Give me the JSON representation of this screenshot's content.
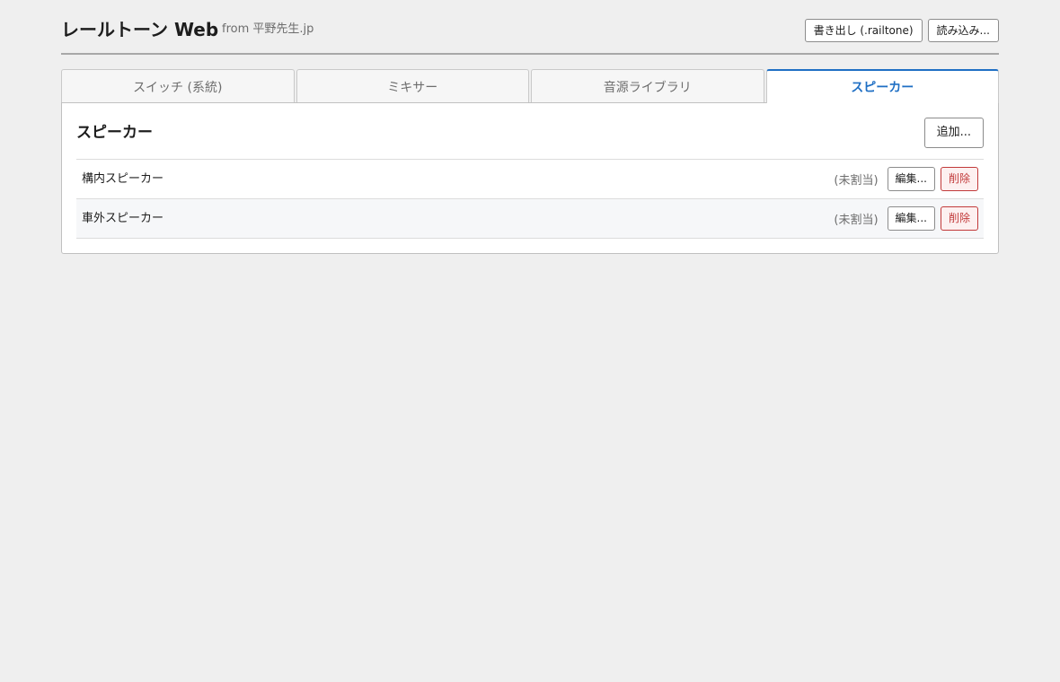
{
  "app": {
    "title": "レールトーン Web",
    "subtitle": "from 平野先生.jp",
    "export_label": "書き出し (.railtone)",
    "import_label": "読み込み..."
  },
  "tabs": [
    {
      "label": "スイッチ (系統)",
      "active": false
    },
    {
      "label": "ミキサー",
      "active": false
    },
    {
      "label": "音源ライブラリ",
      "active": false
    },
    {
      "label": "スピーカー",
      "active": true
    }
  ],
  "panel": {
    "title": "スピーカー",
    "add_label": "追加...",
    "rows": [
      {
        "name": "構内スピーカー",
        "status": "(未割当)",
        "edit_label": "編集...",
        "delete_label": "削除"
      },
      {
        "name": "車外スピーカー",
        "status": "(未割当)",
        "edit_label": "編集...",
        "delete_label": "削除"
      }
    ]
  },
  "colors": {
    "accent": "#1f6fc4",
    "danger": "#c23a3a",
    "background": "#efefef"
  }
}
